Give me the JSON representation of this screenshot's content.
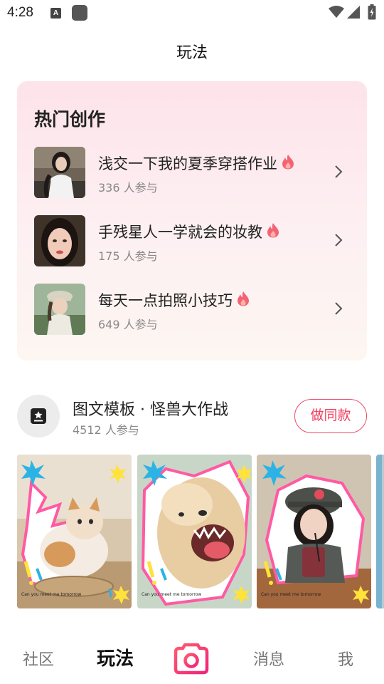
{
  "status_bar": {
    "time": "4:28",
    "notif_letter": "A"
  },
  "header": {
    "title": "玩法"
  },
  "hot": {
    "title": "热门创作",
    "items": [
      {
        "title": "浅交一下我的夏季穿搭作业",
        "count": "336 人参与"
      },
      {
        "title": "手残星人一学就会的妆教",
        "count": "175 人参与"
      },
      {
        "title": "每天一点拍照小技巧",
        "count": "649 人参与"
      }
    ]
  },
  "template": {
    "title": "图文模板 · 怪兽大作战",
    "count": "4512 人参与",
    "button_label": "做同款"
  },
  "gallery": {
    "caption": "Can you meet me tomorrow"
  },
  "nav": {
    "items": [
      "社区",
      "玩法",
      "消息",
      "我"
    ],
    "active": "玩法"
  },
  "colors": {
    "accent": "#ef3f60",
    "card_bg": "#fde3ea"
  }
}
